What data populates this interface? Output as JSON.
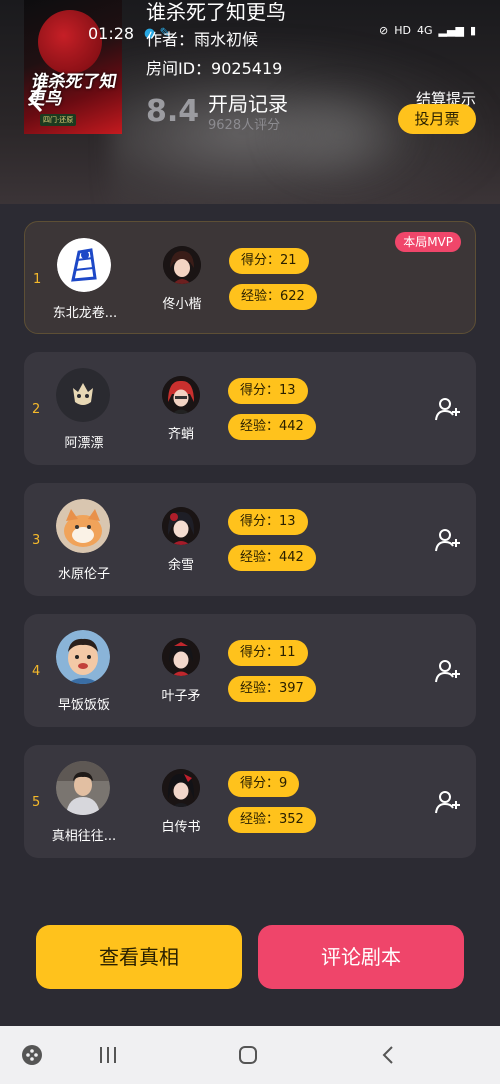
{
  "status_bar": {
    "time": "01:28",
    "network": "HD",
    "signal": "4G"
  },
  "header": {
    "cover_title": "谁杀死了知更鸟",
    "cover_badge": "四门·还原",
    "script_title": "谁杀死了知更鸟",
    "author": "作者：雨水初候",
    "room": "房间ID：9025419",
    "rating": "8.4",
    "log_title": "开局记录",
    "rating_count": "9628人评分",
    "settle_tip": "结算提示",
    "vote_label": "投月票"
  },
  "players": [
    {
      "rank": "1",
      "user": "东北龙卷...",
      "character": "佟小楷",
      "score": "得分：21",
      "exp": "经验：622",
      "mvp": "本局MVP"
    },
    {
      "rank": "2",
      "user": "阿漂漂",
      "character": "齐蛸",
      "score": "得分：13",
      "exp": "经验：442"
    },
    {
      "rank": "3",
      "user": "水原伦子",
      "character": "余雪",
      "score": "得分：13",
      "exp": "经验：442"
    },
    {
      "rank": "4",
      "user": "早饭饭饭",
      "character": "叶子矛",
      "score": "得分：11",
      "exp": "经验：397"
    },
    {
      "rank": "5",
      "user": "真相往往...",
      "character": "白传书",
      "score": "得分：9",
      "exp": "经验：352"
    }
  ],
  "actions": {
    "view_truth": "查看真相",
    "comment_script": "评论剧本"
  },
  "colors": {
    "accent_yellow": "#ffc21c",
    "accent_pink": "#ef456a",
    "background": "#2c2b33",
    "card": "#39373f"
  },
  "icons": {
    "back": "back-arrow-icon",
    "add_friend": "add-friend-icon",
    "nav_game": "game-launcher-icon",
    "nav_recent": "recent-apps-icon",
    "nav_home": "home-icon",
    "nav_back": "nav-back-icon"
  }
}
